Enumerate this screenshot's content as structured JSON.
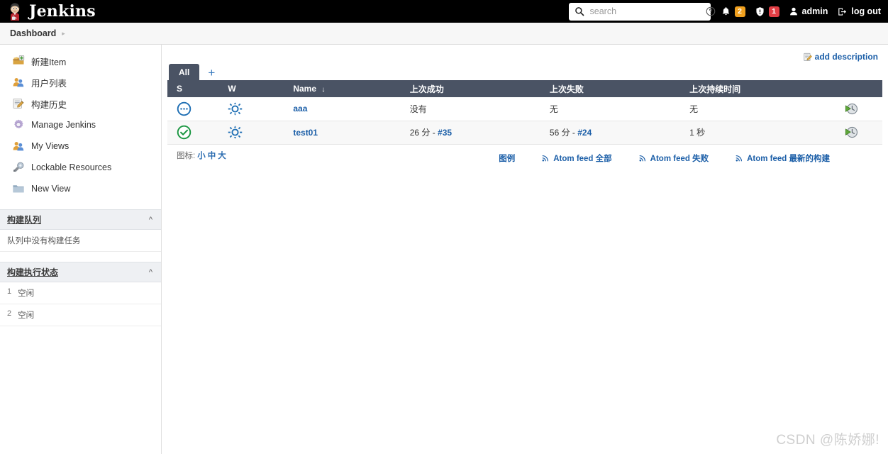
{
  "header": {
    "brand": "Jenkins",
    "logo_icon": "jenkins-butler-logo",
    "search": {
      "placeholder": "search",
      "value": "",
      "icon": "search-icon",
      "help_icon": "help-circle-icon"
    },
    "notifications": {
      "icon": "bell-icon",
      "count": "2",
      "color": "#f0a01e"
    },
    "security": {
      "icon": "shield-alert-icon",
      "count": "1",
      "color": "#e23e45"
    },
    "user": {
      "icon": "person-icon",
      "label": "admin"
    },
    "logout": {
      "icon": "logout-icon",
      "label": "log out"
    }
  },
  "breadcrumb": {
    "items": [
      "Dashboard"
    ],
    "chevron": "chevron-right-icon"
  },
  "sidebar": {
    "items": [
      {
        "label": "新建Item",
        "icon": "new-item-icon"
      },
      {
        "label": "用户列表",
        "icon": "people-icon"
      },
      {
        "label": "构建历史",
        "icon": "history-edit-icon"
      },
      {
        "label": "Manage Jenkins",
        "icon": "gear-icon"
      },
      {
        "label": "My Views",
        "icon": "people-icon"
      },
      {
        "label": "Lockable Resources",
        "icon": "lock-resource-icon"
      },
      {
        "label": "New View",
        "icon": "folder-icon"
      }
    ],
    "build_queue": {
      "title": "构建队列",
      "caret": "chevron-up-icon",
      "empty_text": "队列中没有构建任务"
    },
    "build_executor": {
      "title": "构建执行状态",
      "caret": "chevron-up-icon",
      "executors": [
        {
          "num": "1",
          "status": "空闲"
        },
        {
          "num": "2",
          "status": "空闲"
        }
      ]
    }
  },
  "main": {
    "add_description": {
      "label": "add description",
      "icon": "edit-note-icon"
    },
    "tabs": [
      {
        "label": "All",
        "active": true
      }
    ],
    "add_tab": {
      "label": "+"
    },
    "table": {
      "columns": [
        "S",
        "W",
        "Name",
        "上次成功",
        "上次失败",
        "上次持续时间",
        ""
      ],
      "sort_indicator": "↓",
      "sorted_column": "Name",
      "rows": [
        {
          "status_icon": "status-pending-icon",
          "weather_icon": "weather-sunny-icon",
          "name": "aaa",
          "last_success": "没有",
          "last_success_build": "",
          "last_failure": "无",
          "last_failure_build": "",
          "last_duration": "无",
          "action_icon": "schedule-build-icon"
        },
        {
          "status_icon": "status-success-icon",
          "weather_icon": "weather-sunny-icon",
          "name": "test01",
          "last_success": "26 分 - ",
          "last_success_build": "#35",
          "last_failure": "56 分 - ",
          "last_failure_build": "#24",
          "last_duration": "1 秒",
          "action_icon": "schedule-build-icon"
        }
      ]
    },
    "icon_size": {
      "label": "图标:",
      "options": [
        "小",
        "中",
        "大"
      ]
    },
    "footer_links": [
      {
        "label": "图例",
        "icon": ""
      },
      {
        "label": "Atom feed 全部",
        "icon": "rss-icon"
      },
      {
        "label": "Atom feed 失败",
        "icon": "rss-icon"
      },
      {
        "label": "Atom feed 最新的构建",
        "icon": "rss-icon"
      }
    ]
  },
  "watermark": "CSDN @陈娇娜!",
  "colors": {
    "topbar_bg": "#000000",
    "table_header_bg": "#4a5364",
    "link_blue": "#1c5fa8",
    "success_green": "#1a9641",
    "pending_blue": "#1f6fb4",
    "badge_orange": "#f0a01e",
    "badge_red": "#e23e45"
  }
}
